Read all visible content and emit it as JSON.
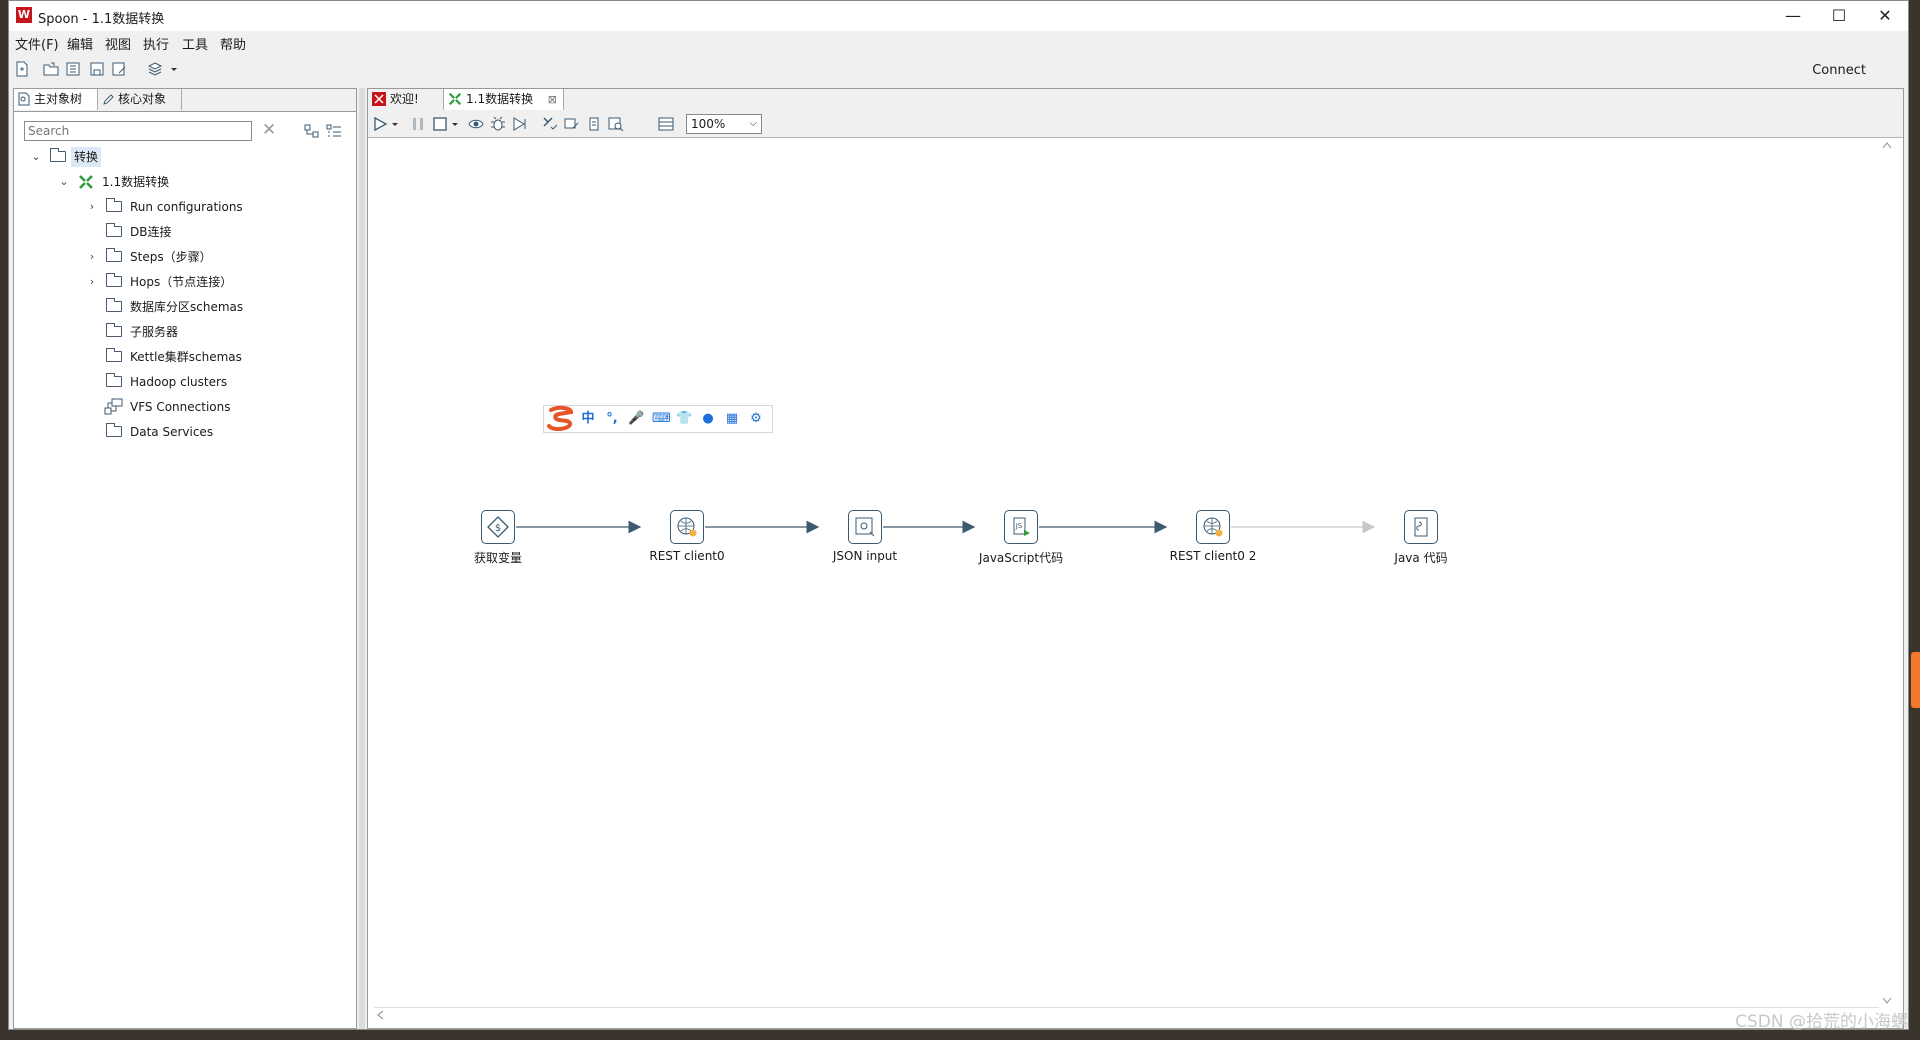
{
  "window": {
    "title": "Spoon - 1.1数据转换",
    "app_icon_glyph": "W",
    "minimize": "—",
    "maximize": "☐",
    "close": "✕"
  },
  "menu": [
    "文件(F)",
    "编辑",
    "视图",
    "执行",
    "工具",
    "帮助"
  ],
  "toolbar": {
    "connect_label": "Connect"
  },
  "left_panel": {
    "tabs": [
      {
        "label": "主对象树",
        "active": true
      },
      {
        "label": "核心对象",
        "active": false
      }
    ],
    "search_placeholder": "Search",
    "tree": {
      "root": "转换",
      "transformation": "1.1数据转换",
      "items": [
        {
          "label": "Run configurations",
          "expandable": true
        },
        {
          "label": "DB连接",
          "expandable": false
        },
        {
          "label": "Steps（步骤）",
          "expandable": true
        },
        {
          "label": "Hops（节点连接）",
          "expandable": true
        },
        {
          "label": "数据库分区schemas",
          "expandable": false
        },
        {
          "label": "子服务器",
          "expandable": false
        },
        {
          "label": "Kettle集群schemas",
          "expandable": false
        },
        {
          "label": "Hadoop clusters",
          "expandable": false
        },
        {
          "label": "VFS Connections",
          "expandable": false
        },
        {
          "label": "Data Services",
          "expandable": false
        }
      ]
    }
  },
  "editor": {
    "tabs": [
      {
        "label": "欢迎!"
      },
      {
        "label": "1.1数据转换",
        "close": "⊠"
      }
    ],
    "zoom": "100%",
    "steps": [
      {
        "label": "获取变量"
      },
      {
        "label": "REST client0"
      },
      {
        "label": "JSON input"
      },
      {
        "label": "JavaScript代码"
      },
      {
        "label": "REST client0 2"
      },
      {
        "label": "Java 代码"
      }
    ]
  },
  "ime_toolbar": [
    "中",
    "°,",
    "🎤",
    "⌨",
    "👕",
    "●",
    "▦",
    "⚙"
  ],
  "watermark": "CSDN @拾荒的小海螺",
  "colors": {
    "accent": "#1a6fd8",
    "step_border": "#3a5a72",
    "hop": "#3d5a6e",
    "hop_disabled": "#c8c8c8",
    "spoon_red": "#c4161c",
    "ime_orange": "#e8542a"
  }
}
